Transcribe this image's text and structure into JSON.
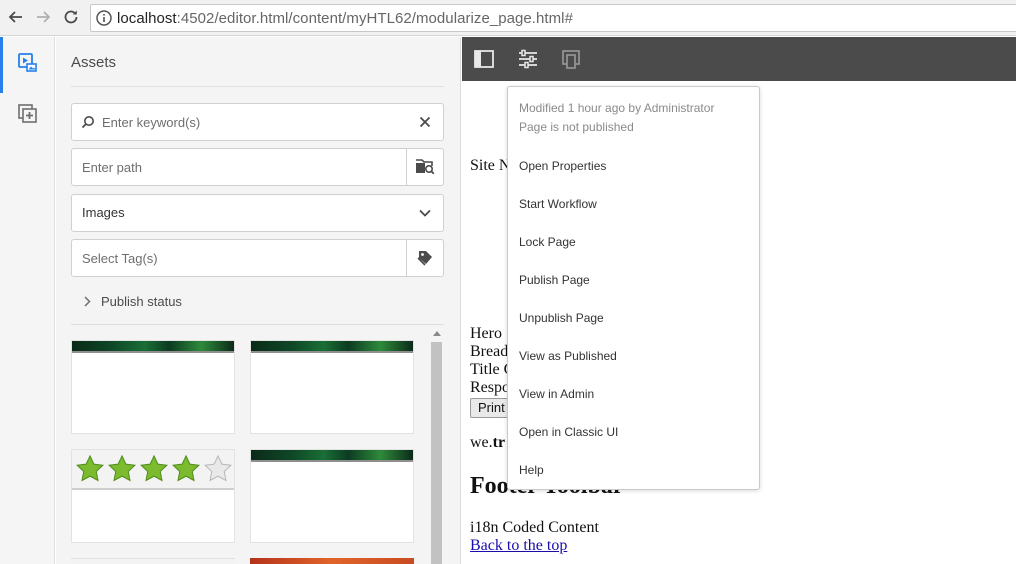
{
  "browser": {
    "url_host": "localhost",
    "url_rest": ":4502/editor.html/content/myHTL62/modularize_page.html#"
  },
  "rail": {
    "items": [
      {
        "icon": "assets-icon",
        "active": true
      },
      {
        "icon": "components-icon",
        "active": false
      }
    ]
  },
  "panel": {
    "title": "Assets",
    "search_placeholder": "Enter keyword(s)",
    "path_placeholder": "Enter path",
    "asset_type": "Images",
    "tags_placeholder": "Select Tag(s)",
    "publish_status": "Publish status"
  },
  "page": {
    "site_nav": "Site N",
    "hero": "Hero",
    "bread": "Bread",
    "title_c": "Title C",
    "respo": "Respo",
    "print_btn": "Print",
    "we_prefix": "we.",
    "we_bold": "tr",
    "footer_heading": "Footer Toolbar",
    "i18n": "i18n Coded Content",
    "back_to_top": "Back to the top"
  },
  "page_info": {
    "modified": "Modified 1 hour ago by Administrator",
    "status": "Page is not published",
    "items": [
      "Open Properties",
      "Start Workflow",
      "Lock Page",
      "Publish Page",
      "Unpublish Page",
      "View as Published",
      "View in Admin",
      "Open in Classic UI",
      "Help"
    ]
  },
  "colors": {
    "toolbar": "#4b4b4b",
    "accent": "#2680eb",
    "link": "#1a0dab"
  }
}
